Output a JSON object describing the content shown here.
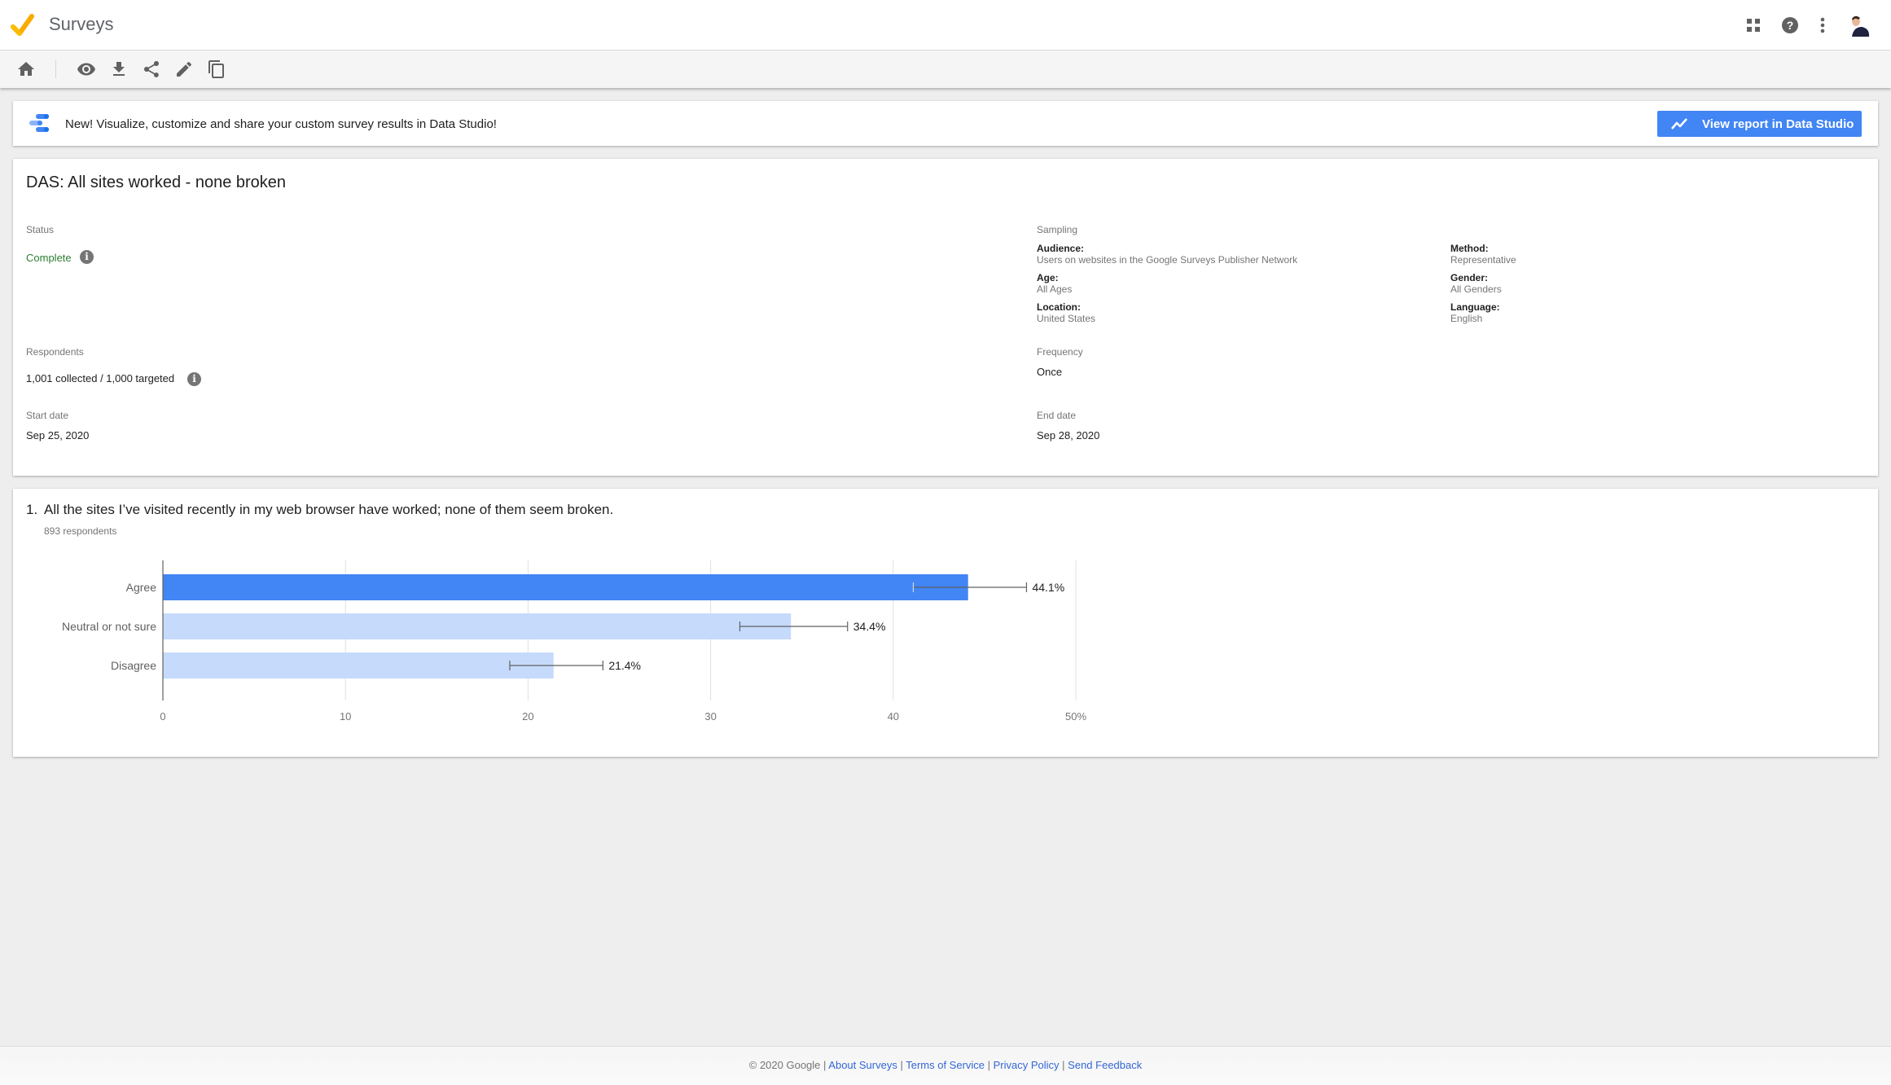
{
  "app": {
    "title": "Surveys",
    "icons": [
      "apps-grid-icon",
      "help-icon",
      "more-vert-icon",
      "account-avatar"
    ]
  },
  "toolbar": {
    "icons": [
      "home-icon",
      "preview-eye-icon",
      "download-icon",
      "share-icon",
      "edit-pencil-icon",
      "copy-icon"
    ]
  },
  "banner": {
    "text": "New! Visualize, customize and share your custom survey results in Data Studio!",
    "button_label": "View report in Data Studio",
    "accent": "#4285f4"
  },
  "survey": {
    "title": "DAS: All sites worked - none broken",
    "status_label": "Status",
    "status_value": "Complete",
    "status_color": "#2e7d32",
    "respondents_label": "Respondents",
    "respondents_value": "1,001 collected / 1,000 targeted",
    "start_label": "Start date",
    "start_value": "Sep 25, 2020",
    "sampling_label": "Sampling",
    "sampling": {
      "audience_key": "Audience:",
      "audience_val": "Users on websites in the Google Surveys Publisher Network",
      "method_key": "Method:",
      "method_val": "Representative",
      "age_key": "Age:",
      "age_val": "All Ages",
      "gender_key": "Gender:",
      "gender_val": "All Genders",
      "location_key": "Location:",
      "location_val": "United States",
      "language_key": "Language:",
      "language_val": "English"
    },
    "frequency_label": "Frequency",
    "frequency_value": "Once",
    "end_label": "End date",
    "end_value": "Sep 28, 2020"
  },
  "question": {
    "number": "1.",
    "text": "All the sites I’ve visited recently in my web browser have worked; none of them seem broken.",
    "respondents": "893 respondents"
  },
  "chart_data": {
    "type": "bar",
    "orientation": "horizontal",
    "title": "",
    "xlabel": "",
    "ylabel": "",
    "categories": [
      "Agree",
      "Neutral or not sure",
      "Disagree"
    ],
    "values": [
      44.1,
      34.4,
      21.4
    ],
    "value_labels": [
      "44.1%",
      "34.4%",
      "21.4%"
    ],
    "error_low": [
      41.1,
      31.6,
      19.0
    ],
    "error_high": [
      47.3,
      37.5,
      24.1
    ],
    "xlim": [
      0,
      50
    ],
    "xticks": [
      0,
      10,
      20,
      30,
      40,
      50
    ],
    "xtick_labels": [
      "0",
      "10",
      "20",
      "30",
      "40",
      "50%"
    ],
    "grid": true,
    "colors": [
      "#4285f4",
      "#c6dafc",
      "#c6dafc"
    ]
  },
  "footer": {
    "copyright": "© 2020 Google",
    "separator": " | ",
    "links": [
      "About Surveys",
      "Terms of Service",
      "Privacy Policy",
      "Send Feedback"
    ]
  }
}
